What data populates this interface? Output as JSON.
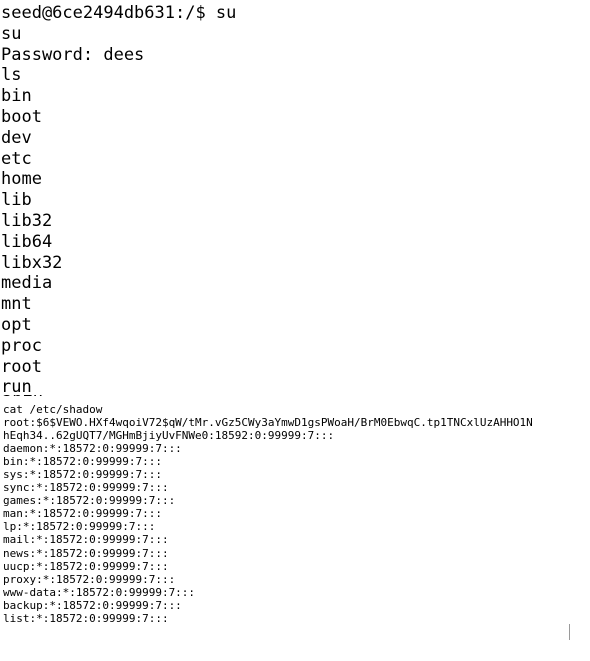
{
  "terminal_top": {
    "lines": [
      "seed@6ce2494db631:/$ su",
      "su",
      "Password: dees",
      "ls",
      "bin",
      "boot",
      "dev",
      "etc",
      "home",
      "lib",
      "lib32",
      "lib64",
      "libx32",
      "media",
      "mnt",
      "opt",
      "proc",
      "root",
      "run"
    ],
    "partial_line": "sbin"
  },
  "terminal_bottom": {
    "lines": [
      "cat /etc/shadow",
      "root:$6$VEWO.HXf4wqoiV72$qW/tMr.vGz5CWy3aYmwD1gsPWoaH/BrM0EbwqC.tp1TNCxlUzAHHO1N",
      "hEqh34..62gUQT7/MGHmBjiyUvFNWe0:18592:0:99999:7:::",
      "daemon:*:18572:0:99999:7:::",
      "bin:*:18572:0:99999:7:::",
      "sys:*:18572:0:99999:7:::",
      "sync:*:18572:0:99999:7:::",
      "games:*:18572:0:99999:7:::",
      "man:*:18572:0:99999:7:::",
      "lp:*:18572:0:99999:7:::",
      "mail:*:18572:0:99999:7:::",
      "news:*:18572:0:99999:7:::",
      "uucp:*:18572:0:99999:7:::",
      "proxy:*:18572:0:99999:7:::",
      "www-data:*:18572:0:99999:7:::",
      "backup:*:18572:0:99999:7:::",
      "list:*:18572:0:99999:7:::"
    ]
  },
  "colors": {
    "background": "#ffffff",
    "text": "#000000",
    "scroll_indicator": "#9a9a9a"
  }
}
